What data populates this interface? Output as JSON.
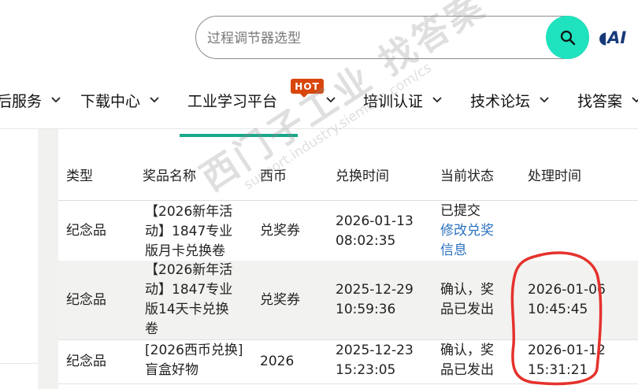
{
  "header": {
    "search_placeholder": "过程调节器选型",
    "logo_text": "AI",
    "logo_mark": "◖"
  },
  "nav": {
    "items": [
      {
        "label": "后服务"
      },
      {
        "label": "下载中心"
      },
      {
        "label": "工业学习平台"
      },
      {
        "label": "培训认证"
      },
      {
        "label": "技术论坛"
      },
      {
        "label": "找答案"
      }
    ],
    "hot_badge": "HOT"
  },
  "table": {
    "headers": [
      "类型",
      "奖品名称",
      "西币",
      "兑换时间",
      "当前状态",
      "处理时间"
    ],
    "rows": [
      {
        "type": "纪念品",
        "name_lines": [
          "【2026新年活",
          "动】1847专业",
          "版月卡兑换卷"
        ],
        "currency": "兑奖券",
        "time_lines": [
          "2026-01-13",
          "08:02:35"
        ],
        "status_lines": [
          "已提交"
        ],
        "status_link_lines": [
          "修改兑奖",
          "信息"
        ],
        "processed_lines": [
          "",
          ""
        ]
      },
      {
        "type": "纪念品",
        "name_lines": [
          "【2026新年活",
          "动】1847专业",
          "版14天卡兑换",
          "卷"
        ],
        "currency": "兑奖券",
        "time_lines": [
          "2025-12-29",
          "10:59:36"
        ],
        "status_lines": [
          "确认，奖",
          "品已发出"
        ],
        "processed_lines": [
          "2026-01-06",
          "10:45:45"
        ]
      },
      {
        "type": "纪念品",
        "name_lines": [
          "[2026西币兑换]",
          "盲盒好物"
        ],
        "currency": "2026",
        "time_lines": [
          "2025-12-23",
          "15:23:05"
        ],
        "status_lines": [
          "确认，奖",
          "品已发出"
        ],
        "processed_lines": [
          "2026-01-12",
          "15:31:21"
        ]
      }
    ]
  },
  "watermark": {
    "main": "西门子工业 找答案",
    "url": "support.industry.siemens.com/cs"
  },
  "colors": {
    "search_button": "#1fe2be",
    "hot_badge": "#d9460b",
    "nav_underline": "#1aa88b",
    "link": "#2a72c2",
    "annotation": "#e5322d",
    "alt_row": "#f2f2f0"
  }
}
